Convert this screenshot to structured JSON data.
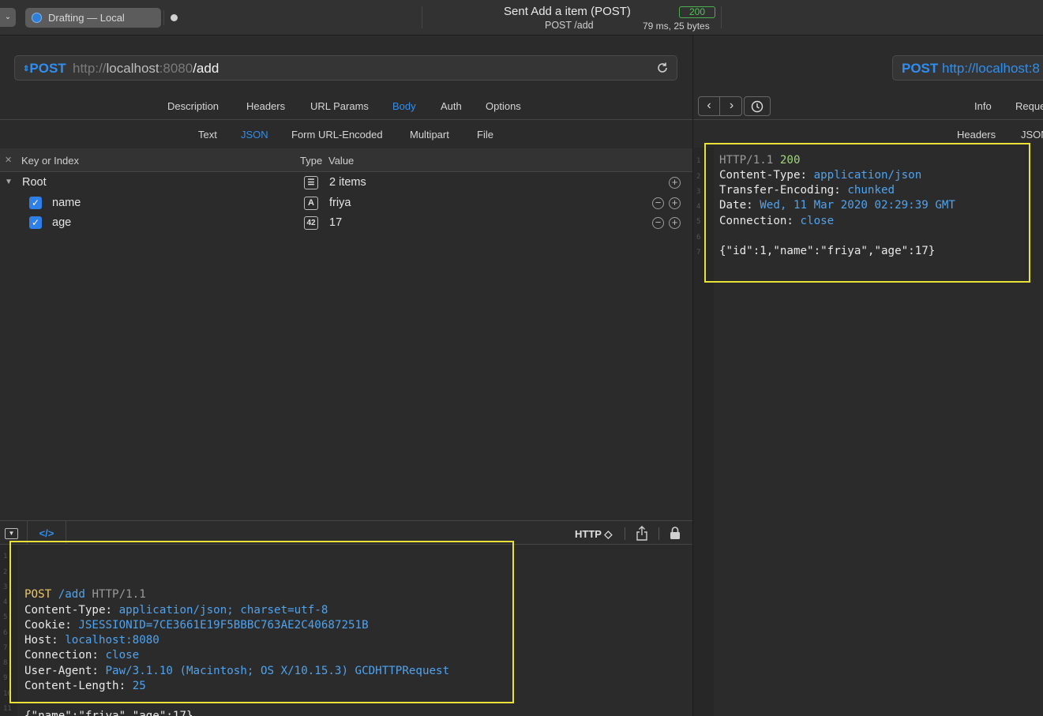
{
  "titlebar": {
    "document_title": "Drafting — Local",
    "status_title": "Sent Add a item (POST)",
    "status_path": "POST /add",
    "status_code": "200",
    "status_meta": "79 ms, 25 bytes"
  },
  "request": {
    "method": "POST",
    "url_scheme": "http://",
    "url_host": "localhost",
    "url_port": ":8080",
    "url_path": "/add"
  },
  "tabs": {
    "main": [
      "Description",
      "Headers",
      "URL Params",
      "Body",
      "Auth",
      "Options"
    ],
    "main_active": "Body",
    "body": [
      "Text",
      "JSON",
      "Form URL-Encoded",
      "Multipart",
      "File"
    ],
    "body_active": "JSON"
  },
  "json_table": {
    "headers": {
      "key": "Key or Index",
      "type": "Type",
      "value": "Value"
    },
    "root": {
      "label": "Root",
      "type_icon": "list-icon",
      "value": "2 items"
    },
    "rows": [
      {
        "key": "name",
        "type_badge": "A",
        "value": "friya"
      },
      {
        "key": "age",
        "type_badge": "42",
        "value": "17"
      }
    ]
  },
  "code_toolbar": {
    "format": "HTTP ◇"
  },
  "request_code": {
    "line1": {
      "method": "POST",
      "path": "/add",
      "proto": "HTTP/1.1"
    },
    "headers": [
      {
        "k": "Content-Type",
        "v": "application/json; charset=utf-8"
      },
      {
        "k": "Cookie",
        "v": "JSESSIONID=7CE3661E19F5BBBC763AE2C40687251B"
      },
      {
        "k": "Host",
        "v": "localhost:8080"
      },
      {
        "k": "Connection",
        "v": "close"
      },
      {
        "k": "User-Agent",
        "v": "Paw/3.1.10 (Macintosh; OS X/10.15.3) GCDHTTPRequest"
      },
      {
        "k": "Content-Length",
        "v": "25"
      }
    ],
    "body": "{\"name\":\"friya\",\"age\":17}",
    "line_numbers": [
      "1",
      "2",
      "3",
      "4",
      "5",
      "6",
      "7",
      "8",
      "9",
      "10",
      "11"
    ]
  },
  "response": {
    "url_method": "POST",
    "url_text": "http://localhost:8",
    "tabs": {
      "info": "Info",
      "request": "Reque"
    },
    "subtabs": {
      "headers": "Headers",
      "json": "JSON"
    },
    "status_line": {
      "proto": "HTTP/1.1",
      "code": "200"
    },
    "headers": [
      {
        "k": "Content-Type",
        "v": "application/json"
      },
      {
        "k": "Transfer-Encoding",
        "v": "chunked"
      },
      {
        "k": "Date",
        "v": "Wed, 11 Mar 2020 02:29:39 GMT"
      },
      {
        "k": "Connection",
        "v": "close"
      }
    ],
    "body": "{\"id\":1,\"name\":\"friya\",\"age\":17}",
    "line_numbers": [
      "1",
      "2",
      "3",
      "4",
      "5",
      "6",
      "7"
    ]
  },
  "colors": {
    "accent": "#2f8ff0",
    "highlight": "#e8e137",
    "status_ok": "#54c25a"
  }
}
